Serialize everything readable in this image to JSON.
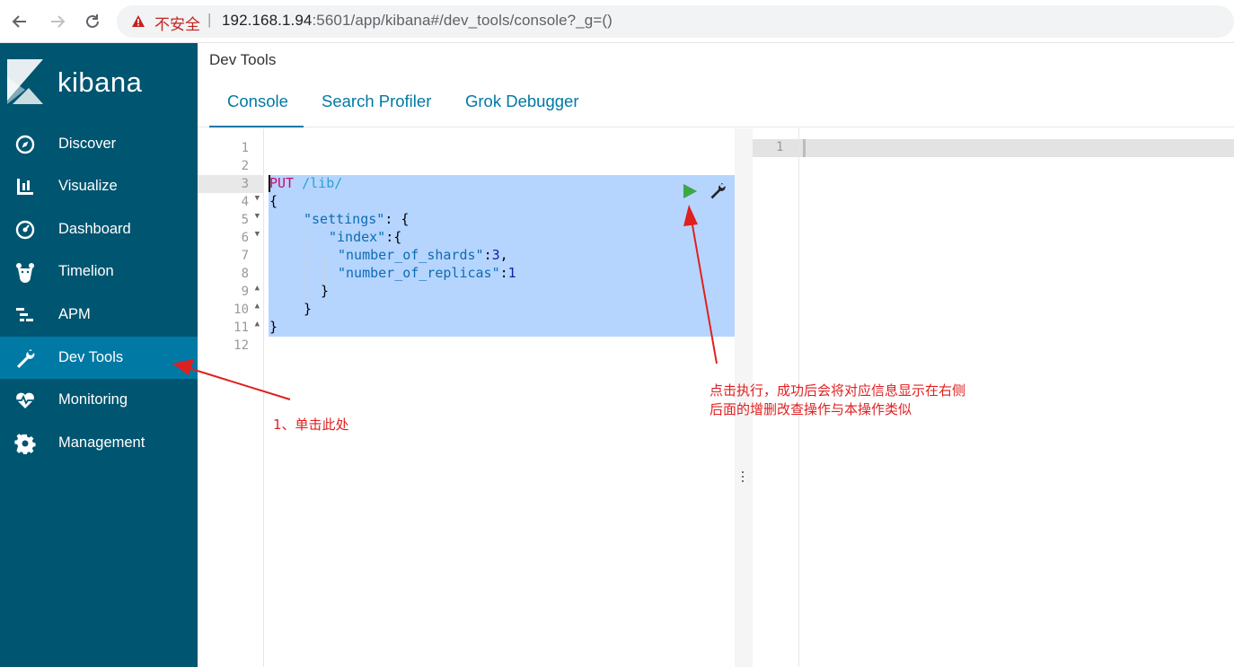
{
  "browser": {
    "back_icon": "arrow-left-icon",
    "forward_icon": "arrow-right-icon",
    "reload_icon": "reload-icon",
    "security_warning": "不安全",
    "separator": "|",
    "url_host": "192.168.1.94",
    "url_rest": ":5601/app/kibana#/dev_tools/console?_g=()"
  },
  "sidebar": {
    "logo_text": "kibana",
    "items": [
      {
        "label": "Discover",
        "icon": "compass-icon"
      },
      {
        "label": "Visualize",
        "icon": "bar-chart-icon"
      },
      {
        "label": "Dashboard",
        "icon": "dashboard-gauge-icon"
      },
      {
        "label": "Timelion",
        "icon": "timelion-bear-icon"
      },
      {
        "label": "APM",
        "icon": "apm-icon"
      },
      {
        "label": "Dev Tools",
        "icon": "wrench-icon",
        "active": true
      },
      {
        "label": "Monitoring",
        "icon": "heartbeat-icon"
      },
      {
        "label": "Management",
        "icon": "gear-icon"
      }
    ],
    "colors": {
      "background": "#005571",
      "active": "#0079a5"
    }
  },
  "header": {
    "title": "Dev Tools",
    "tabs": [
      {
        "label": "Console",
        "active": true
      },
      {
        "label": "Search Profiler"
      },
      {
        "label": "Grok Debugger"
      }
    ]
  },
  "editor": {
    "line_numbers": [
      "1",
      "2",
      "3",
      "4",
      "5",
      "6",
      "7",
      "8",
      "9",
      "10",
      "11",
      "12"
    ],
    "code": {
      "method": "PUT",
      "path": " /lib/",
      "open_brace": "{",
      "settings_key": "\"settings\"",
      "settings_rest": ": {",
      "index_key": "\"index\"",
      "index_rest": ":{",
      "shards_key": "\"number_of_shards\"",
      "shards_value": "3",
      "replicas_key": "\"number_of_replicas\"",
      "replicas_value": "1",
      "close_brace": "}"
    },
    "run_icon": "play-icon",
    "settings_icon": "wrench-icon"
  },
  "output": {
    "line_numbers": [
      "1"
    ]
  },
  "annotations": {
    "step1": "1、单击此处",
    "run_note_line1": "点击执行，成功后会将对应信息显示在右侧",
    "run_note_line2": "后面的增删改查操作与本操作类似",
    "color": "#e02020"
  }
}
